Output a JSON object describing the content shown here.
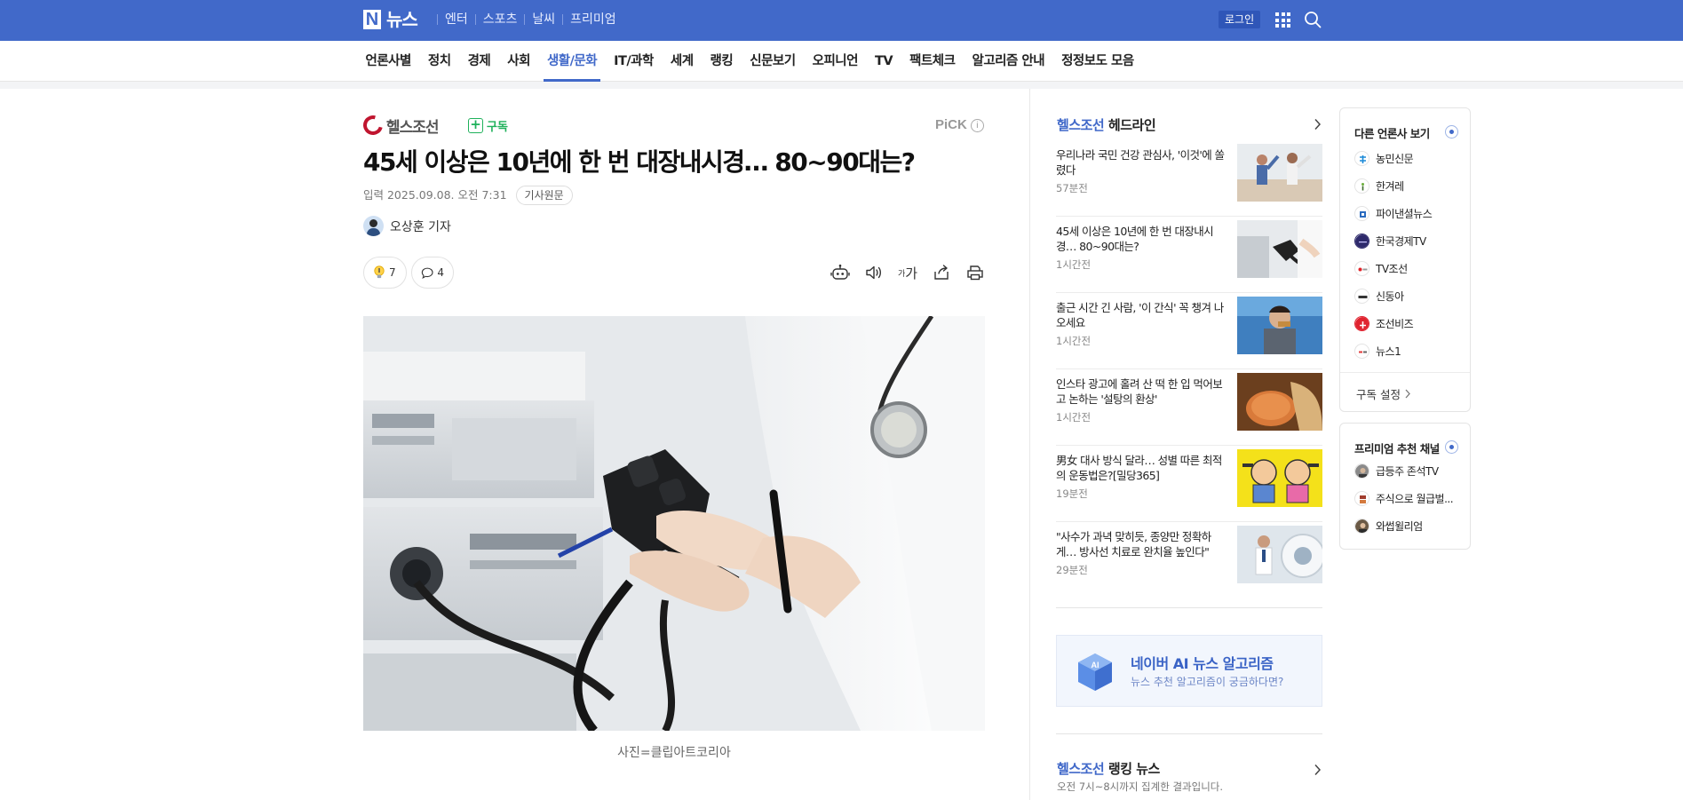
{
  "topbar": {
    "logo_letter": "N",
    "logo_text": "뉴스",
    "menu": [
      "엔터",
      "스포츠",
      "날씨",
      "프리미엄"
    ],
    "login": "로그인"
  },
  "section_nav": {
    "items": [
      "언론사별",
      "정치",
      "경제",
      "사회",
      "생활/문화",
      "IT/과학",
      "세계",
      "랭킹",
      "신문보기",
      "오피니언",
      "TV",
      "팩트체크",
      "알고리즘 안내",
      "정정보도 모음"
    ],
    "active": "생활/문화"
  },
  "article": {
    "press_name": "헬스조선",
    "subscribe": "구독",
    "pick": "PiCK",
    "title": "45세 이상은 10년에 한 번 대장내시경… 80~90대는?",
    "date": "입력 2025.09.08. 오전 7:31",
    "original_link": "기사원문",
    "author": "오상훈 기자",
    "reaction_count": "7",
    "comment_count": "4",
    "tool_font": "가",
    "tool_font_small": "가",
    "photo_caption": "사진=클립아트코리아"
  },
  "headlines": {
    "press": "헬스조선",
    "title_suffix": " 헤드라인",
    "items": [
      {
        "text": "우리나라 국민 건강 관심사, '이것'에 쏠렸다",
        "time": "57분전"
      },
      {
        "text": "45세 이상은 10년에 한 번 대장내시경… 80~90대는?",
        "time": "1시간전"
      },
      {
        "text": "출근 시간 긴 사람, '이 간식' 꼭 챙겨 나오세요",
        "time": "1시간전"
      },
      {
        "text": "인스타 광고에 홀려 산 떡 한 입 먹어보고 논하는 '설탕의 환상'",
        "time": "1시간전"
      },
      {
        "text": "男女 대사 방식 달라… 성별 따른 최적의 운동법은?[밀당365]",
        "time": "19분전"
      },
      {
        "text": "\"사수가 과녁 맞히듯, 종양만 정확하게… 방사선 치료로 완치율 높인다\"",
        "time": "29분전"
      }
    ]
  },
  "ai_banner": {
    "badge": "AI",
    "title": "네이버 AI 뉴스 알고리즘",
    "subtitle": "뉴스 추천 알고리즘이 궁금하다면?"
  },
  "ranking": {
    "press": "헬스조선",
    "title_suffix": " 랭킹 뉴스",
    "subtitle": "오전 7시~8시까지 집계한 결과입니다."
  },
  "other_press": {
    "title": "다른 언론사 보기",
    "items": [
      "농민신문",
      "한겨레",
      "파이낸셜뉴스",
      "한국경제TV",
      "TV조선",
      "신동아",
      "조선비즈",
      "뉴스1"
    ],
    "setting": "구독 설정"
  },
  "premium": {
    "title": "프리미엄 추천 채널",
    "items": [
      "급등주 존석TV",
      "주식으로 월급벌...",
      "와썹윌리엄"
    ]
  },
  "colors": {
    "brand_blue": "#4169c9",
    "subscribe_green": "#1fb15b",
    "press_red": "#c0152f"
  }
}
